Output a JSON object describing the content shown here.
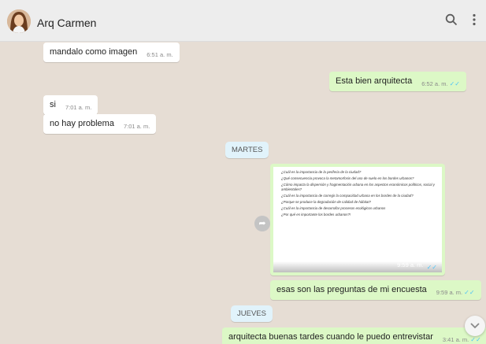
{
  "header": {
    "contact_name": "Arq Carmen",
    "avatar_icon": "profile-photo",
    "search_icon": "search-icon",
    "menu_icon": "more-vert-icon"
  },
  "messages": [
    {
      "dir": "in",
      "text": "mandalo como imagen",
      "time": "6:51 a. m."
    },
    {
      "dir": "out",
      "text": "Esta bien arquitecta",
      "time": "6:52 a. m.",
      "ticks": "✓✓"
    },
    {
      "dir": "in",
      "text": "si",
      "time": "7:01 a. m."
    },
    {
      "dir": "in",
      "text": "no hay problema",
      "time": "7:01 a. m."
    },
    {
      "dir": "out",
      "type": "image",
      "time": "9:59 a. m.",
      "ticks": "✓✓"
    },
    {
      "dir": "out",
      "text": "esas son las preguntas de mi encuesta",
      "time": "9:59 a. m.",
      "ticks": "✓✓"
    },
    {
      "dir": "out",
      "text": "arquitecta buenas tardes cuando le puedo entrevistar",
      "time": "3:41 a. m.",
      "ticks": "✓✓"
    }
  ],
  "day_separators": [
    "MARTES",
    "JUEVES"
  ],
  "image_document": {
    "lines": [
      "¿Cuál es la importancia de la periferia de la ciudad?",
      "¿Qué consecuencia provoca la metamorfosis del uso de suelo en los bordes urbanos?",
      "¿Cómo impacta la dispersión y fragmentación urbana en los aspectos económicos políticos, social y ambientales?",
      "¿Cuál es la importancia de corregir la compacidad urbana en los bordes de la ciudad?",
      "¿Porque se produce la degradación de calidad de hábitat?",
      "¿Cuál es la importancia de desarrollar procesos ecológicos urbanos",
      "¿Por qué es importante los bordes urbanos?!"
    ]
  },
  "controls": {
    "forward_icon": "forward-icon",
    "scroll_down_icon": "chevron-down-icon"
  }
}
